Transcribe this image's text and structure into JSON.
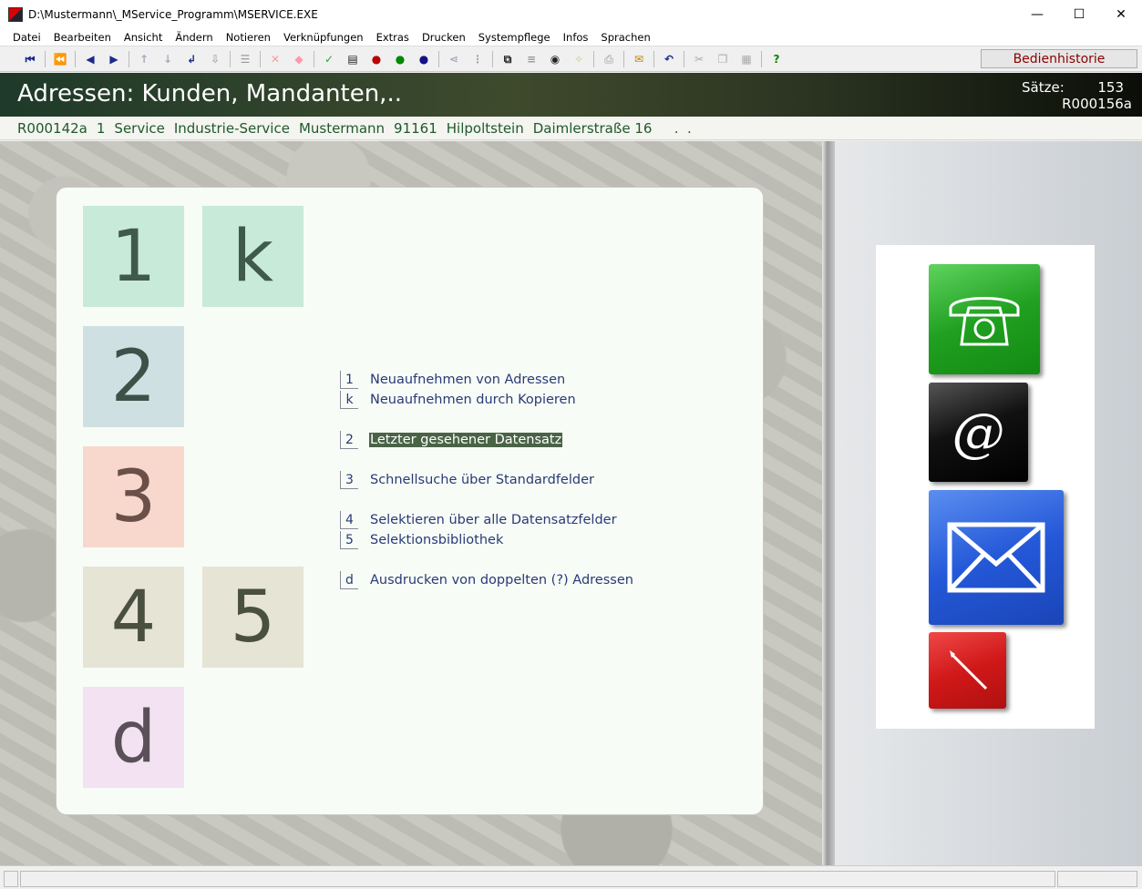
{
  "window": {
    "title": "D:\\Mustermann\\_MService_Programm\\MSERVICE.EXE",
    "minimize": "—",
    "maximize": "☐",
    "close": "✕"
  },
  "menu": [
    "Datei",
    "Bearbeiten",
    "Ansicht",
    "Ändern",
    "Notieren",
    "Verknüpfungen",
    "Extras",
    "Drucken",
    "Systempflege",
    "Infos",
    "Sprachen"
  ],
  "toolbar": {
    "history_button": "Bedienhistorie",
    "icons": [
      "first-record-icon",
      "prev-page-icon",
      "prev-record-icon",
      "next-record-icon",
      "up-icon",
      "down-icon",
      "enter-icon",
      "import-icon",
      "list-icon",
      "delete-icon",
      "erase-icon",
      "check-icon",
      "form-icon",
      "red-snail-icon",
      "green-snail-icon",
      "blue-snail-icon",
      "link-icon",
      "sort-icon",
      "binoculars-icon",
      "lines-icon",
      "eye-icon",
      "clean-icon",
      "print-icon",
      "mail-icon",
      "undo-icon",
      "cut-icon",
      "copy-icon",
      "paste-icon",
      "help-icon"
    ]
  },
  "header": {
    "title": "Adressen: Kunden, Mandanten,..",
    "count_label": "Sätze:",
    "count": "153",
    "code": "R000156a"
  },
  "record": [
    "R000142a",
    "1",
    "Service",
    "Industrie-Service",
    "Mustermann",
    "91161",
    "Hilpoltstein",
    "Daimlerstraße 16",
    "   .  ."
  ],
  "tiles": [
    {
      "key": "1",
      "color": "#c8ead8",
      "text_color": "#3f5a48"
    },
    {
      "key": "k",
      "color": "#c8ead8",
      "text_color": "#3f5a48"
    },
    {
      "key": "2",
      "color": "#cfe0e2",
      "text_color": "#3f5048"
    },
    {
      "key": "3",
      "color": "#f8d8cc",
      "text_color": "#6a5048"
    },
    {
      "key": "4",
      "color": "#e6e4d4",
      "text_color": "#4a5040"
    },
    {
      "key": "5",
      "color": "#e6e4d4",
      "text_color": "#4a5040"
    },
    {
      "key": "d",
      "color": "#f2e2f2",
      "text_color": "#5a5058"
    }
  ],
  "entries": [
    {
      "key": "1",
      "label": "Neuaufnehmen von Adressen"
    },
    {
      "key": "k",
      "label": "Neuaufnehmen durch Kopieren"
    },
    {
      "key": "2",
      "label": "Letzter gesehener Datensatz"
    },
    {
      "key": "3",
      "label": "Schnellsuche über Standardfelder"
    },
    {
      "key": "4",
      "label": "Selektieren über alle Datensatzfelder"
    },
    {
      "key": "5",
      "label": "Selektionsbibliothek"
    },
    {
      "key": "d",
      "label": "Ausdrucken von doppelten (?) Adressen"
    }
  ],
  "comm": {
    "email_symbol": "@"
  }
}
